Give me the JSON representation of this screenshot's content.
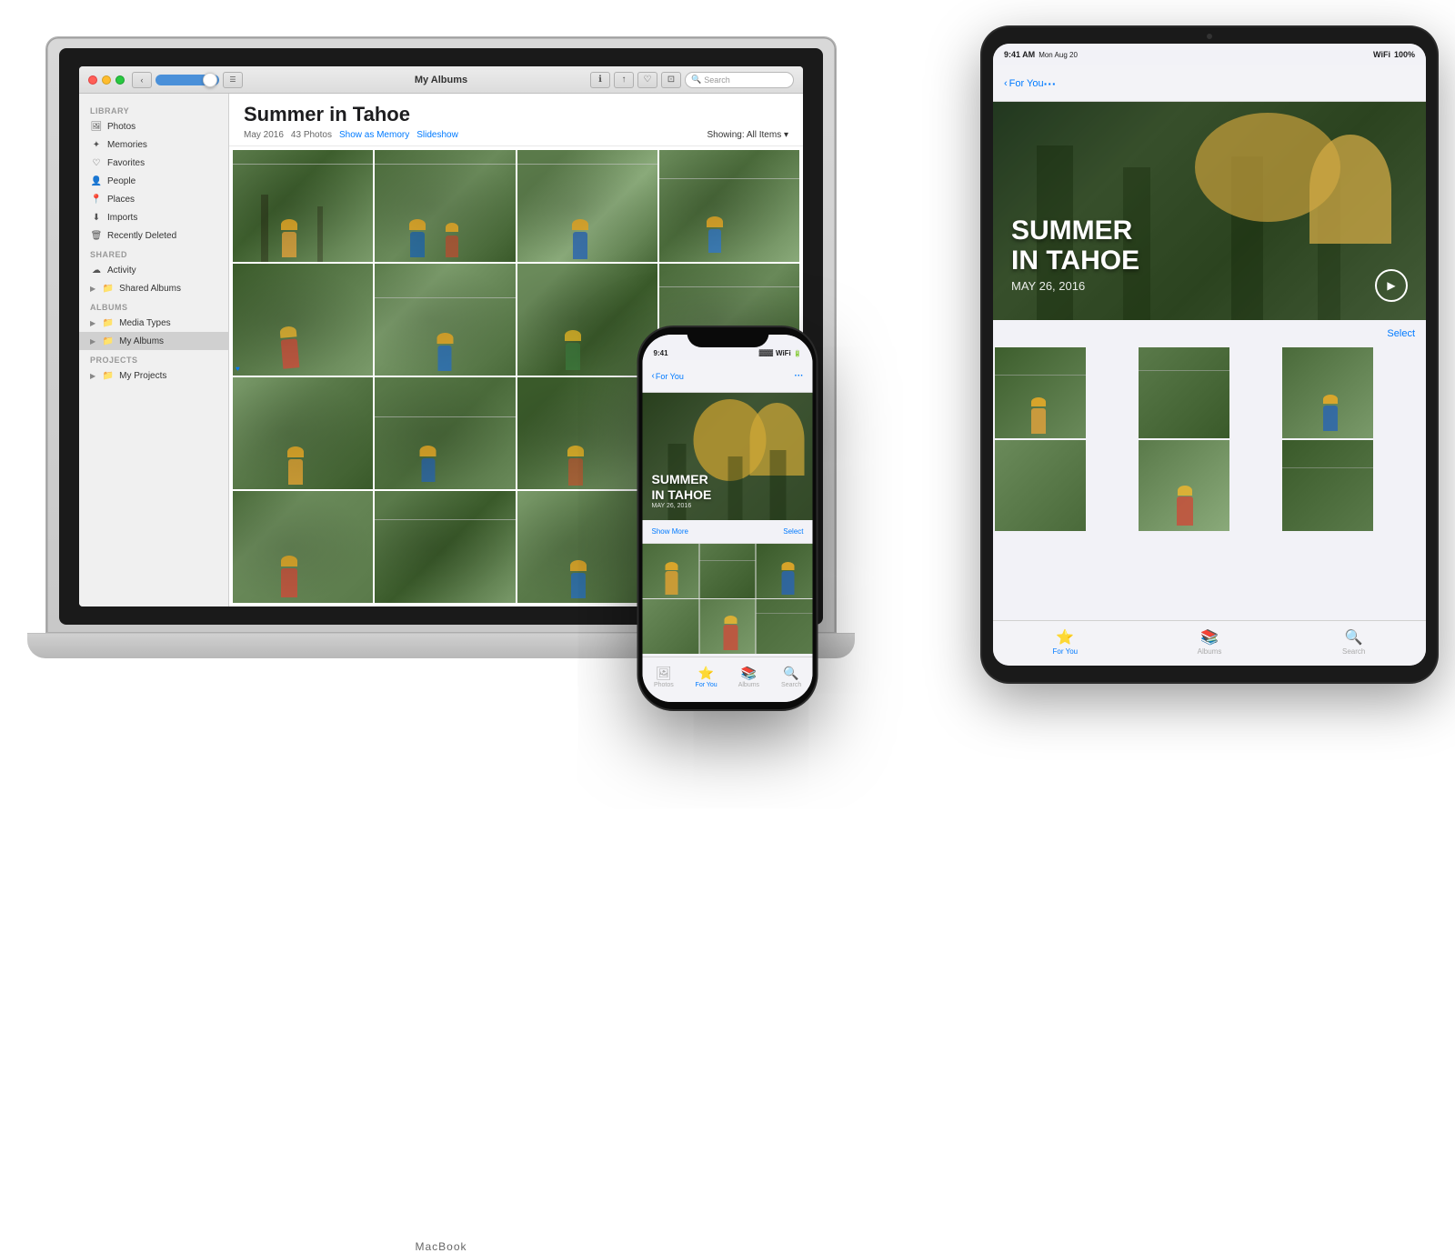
{
  "macbook": {
    "label": "MacBook",
    "titlebar": {
      "title": "My Albums",
      "search_placeholder": "Search"
    },
    "sidebar": {
      "library_header": "Library",
      "shared_header": "Shared",
      "albums_header": "Albums",
      "projects_header": "Projects",
      "items": [
        {
          "id": "photos",
          "label": "Photos",
          "icon": "🖼"
        },
        {
          "id": "memories",
          "label": "Memories",
          "icon": "✦"
        },
        {
          "id": "favorites",
          "label": "Favorites",
          "icon": "♡"
        },
        {
          "id": "people",
          "label": "People",
          "icon": "👤"
        },
        {
          "id": "places",
          "label": "Places",
          "icon": "📍"
        },
        {
          "id": "imports",
          "label": "Imports",
          "icon": "⬇"
        },
        {
          "id": "recently-deleted",
          "label": "Recently Deleted",
          "icon": "🗑"
        },
        {
          "id": "activity",
          "label": "Activity",
          "icon": "☁"
        },
        {
          "id": "shared-albums",
          "label": "Shared Albums",
          "icon": "📁"
        },
        {
          "id": "media-types",
          "label": "Media Types",
          "icon": "📁"
        },
        {
          "id": "my-albums",
          "label": "My Albums",
          "icon": "📁"
        },
        {
          "id": "my-projects",
          "label": "My Projects",
          "icon": "📁"
        }
      ]
    },
    "main": {
      "album_title": "Summer in Tahoe",
      "date": "May 2016",
      "photo_count": "43 Photos",
      "show_as_memory": "Show as Memory",
      "slideshow": "Slideshow",
      "showing": "Showing: All Items ▾"
    }
  },
  "ipad": {
    "statusbar": {
      "time": "9:41 AM",
      "date": "Mon Aug 20",
      "wifi": "WiFi",
      "battery": "100%"
    },
    "navbar": {
      "back_label": "For You",
      "more_icon": "···"
    },
    "hero": {
      "title": "SUMMER\nIN TAHOE",
      "date": "MAY 26, 2016"
    },
    "select_label": "Select",
    "tabs": [
      {
        "id": "for-you",
        "label": "For You",
        "icon": "⭐",
        "active": true
      },
      {
        "id": "albums",
        "label": "Albums",
        "icon": "📚",
        "active": false
      },
      {
        "id": "search",
        "label": "Search",
        "icon": "🔍",
        "active": false
      }
    ]
  },
  "iphone": {
    "statusbar": {
      "time": "9:41",
      "signal": "▓▓▓",
      "wifi": "WiFi",
      "battery": "100%"
    },
    "navbar": {
      "back_label": "For You",
      "more_icon": "···"
    },
    "hero": {
      "title": "SUMMER\nIN TAHOE",
      "date": "MAY 26, 2016"
    },
    "show_more": "Show More",
    "select": "Select",
    "tabs": [
      {
        "id": "photos",
        "label": "Photos",
        "icon": "🖼",
        "active": false
      },
      {
        "id": "for-you",
        "label": "For You",
        "icon": "⭐",
        "active": true
      },
      {
        "id": "albums",
        "label": "Albums",
        "icon": "📚",
        "active": false
      },
      {
        "id": "search",
        "label": "Search",
        "icon": "🔍",
        "active": false
      }
    ]
  },
  "colors": {
    "blue": "#007aff",
    "sidebar_bg": "#f0f0f0",
    "photo_forest": "#4a6a3a",
    "device_dark": "#1a1a1a"
  }
}
